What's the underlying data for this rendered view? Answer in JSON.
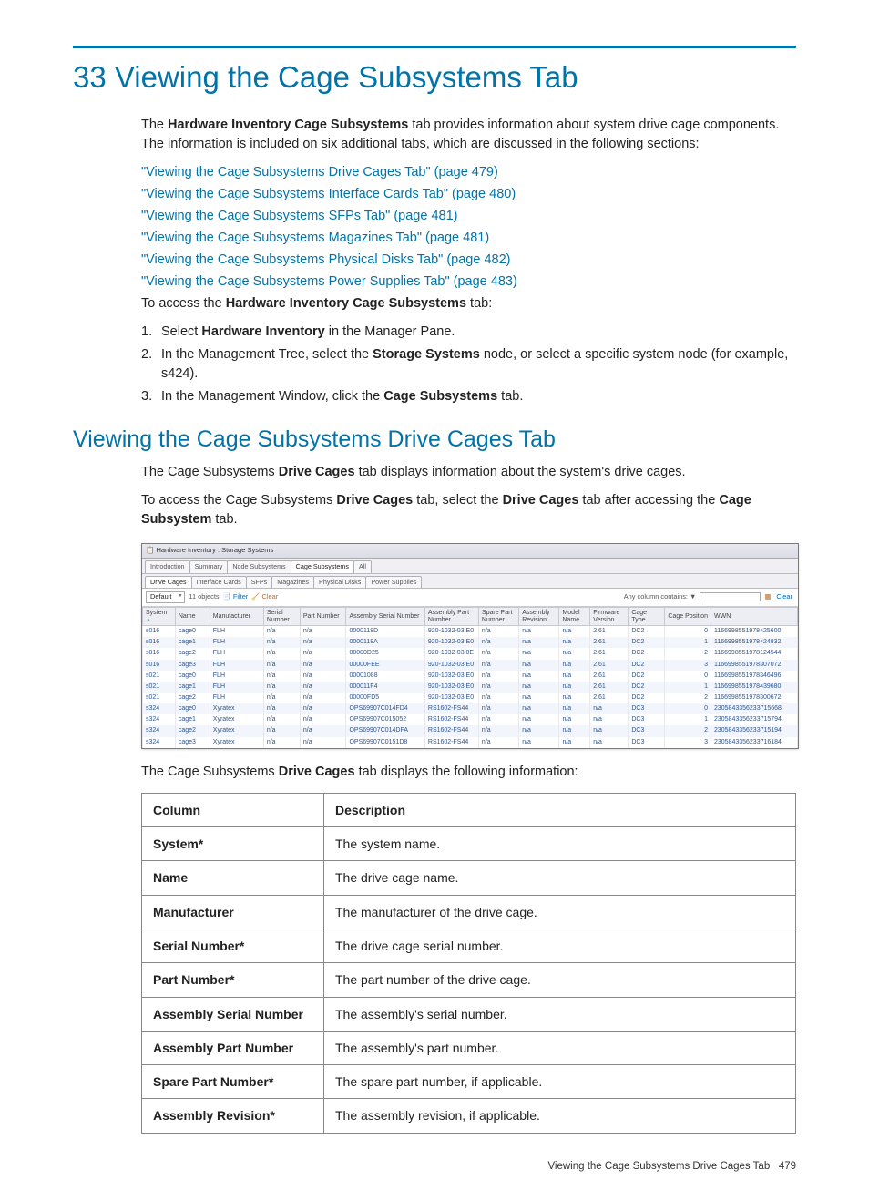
{
  "chapter": {
    "title": "33 Viewing the Cage Subsystems Tab",
    "intro_pre": "The ",
    "intro_bold": "Hardware Inventory Cage Subsystems",
    "intro_post": " tab provides information about system drive cage components. The information is included on six additional tabs, which are discussed in the following sections:",
    "links": [
      "\"Viewing the Cage Subsystems Drive Cages Tab\" (page 479)",
      "\"Viewing the Cage Subsystems Interface Cards Tab\" (page 480)",
      "\"Viewing the Cage Subsystems SFPs Tab\" (page 481)",
      "\"Viewing the Cage Subsystems Magazines Tab\" (page 481)",
      "\"Viewing the Cage Subsystems Physical Disks Tab\" (page 482)",
      "\"Viewing the Cage Subsystems Power Supplies Tab\" (page 483)"
    ],
    "access_pre": "To access the ",
    "access_bold": "Hardware Inventory Cage Subsystems",
    "access_post": " tab:",
    "steps": [
      {
        "n": "1.",
        "pre": "Select ",
        "b": "Hardware Inventory",
        "post": " in the Manager Pane."
      },
      {
        "n": "2.",
        "pre": "In the Management Tree, select the ",
        "b": "Storage Systems",
        "post": " node, or select a specific system node (for example, s424)."
      },
      {
        "n": "3.",
        "pre": "In the Management Window, click the ",
        "b": "Cage Subsystems",
        "post": " tab."
      }
    ]
  },
  "section2": {
    "title": "Viewing the Cage Subsystems Drive Cages Tab",
    "p1_pre": "The Cage Subsystems ",
    "p1_b": "Drive Cages",
    "p1_post": " tab displays information about the system's drive cages.",
    "p2_pre": "To access the Cage Subsystems ",
    "p2_b1": "Drive Cages",
    "p2_mid": " tab, select the ",
    "p2_b2": "Drive Cages",
    "p2_post": " tab after accessing the ",
    "p2_b3": "Cage Subsystem",
    "p2_end": " tab.",
    "p3_pre": "The Cage Subsystems ",
    "p3_b": "Drive Cages",
    "p3_post": " tab displays the following information:"
  },
  "screenshot": {
    "breadcrumb": "Hardware Inventory : Storage Systems",
    "tabs": [
      "Introduction",
      "Summary",
      "Node Subsystems",
      "Cage Subsystems",
      "All"
    ],
    "tabs_active": 3,
    "subtabs": [
      "Drive Cages",
      "Interface Cards",
      "SFPs",
      "Magazines",
      "Physical Disks",
      "Power Supplies"
    ],
    "subtabs_active": 0,
    "default_label": "Default",
    "objects": "11 objects",
    "filter": "Filter",
    "clear_small": "Clear",
    "anycol": "Any column contains:",
    "clear_btn": "Clear",
    "headers": [
      "System",
      "Name",
      "Manufacturer",
      "Serial Number",
      "Part Number",
      "Assembly Serial Number",
      "Assembly Part Number",
      "Spare Part Number",
      "Assembly Revision",
      "Model Name",
      "Firmware Version",
      "Cage Type",
      "Cage Position",
      "WWN"
    ],
    "col_widths": [
      "34",
      "36",
      "56",
      "38",
      "48",
      "82",
      "56",
      "42",
      "42",
      "32",
      "40",
      "38",
      "48",
      "90"
    ],
    "rows": [
      [
        "s016",
        "cage0",
        "FLH",
        "n/a",
        "n/a",
        "0000118D",
        "920-1032-03.E0",
        "n/a",
        "n/a",
        "n/a",
        "2.61",
        "DC2",
        "0",
        "1166998551978425600"
      ],
      [
        "s016",
        "cage1",
        "FLH",
        "n/a",
        "n/a",
        "0000118A",
        "920-1032-03.E0",
        "n/a",
        "n/a",
        "n/a",
        "2.61",
        "DC2",
        "1",
        "1166998551978424832"
      ],
      [
        "s016",
        "cage2",
        "FLH",
        "n/a",
        "n/a",
        "00000D25",
        "920-1032-03.0E",
        "n/a",
        "n/a",
        "n/a",
        "2.61",
        "DC2",
        "2",
        "1166998551978124544"
      ],
      [
        "s016",
        "cage3",
        "FLH",
        "n/a",
        "n/a",
        "00000FEE",
        "920-1032-03.E0",
        "n/a",
        "n/a",
        "n/a",
        "2.61",
        "DC2",
        "3",
        "1166998551978307072"
      ],
      [
        "s021",
        "cage0",
        "FLH",
        "n/a",
        "n/a",
        "00001088",
        "920-1032-03.E0",
        "n/a",
        "n/a",
        "n/a",
        "2.61",
        "DC2",
        "0",
        "1166998551978346496"
      ],
      [
        "s021",
        "cage1",
        "FLH",
        "n/a",
        "n/a",
        "000011F4",
        "920-1032-03.E0",
        "n/a",
        "n/a",
        "n/a",
        "2.61",
        "DC2",
        "1",
        "1166998551978439680"
      ],
      [
        "s021",
        "cage2",
        "FLH",
        "n/a",
        "n/a",
        "00000FD5",
        "920-1032-03.E0",
        "n/a",
        "n/a",
        "n/a",
        "2.61",
        "DC2",
        "2",
        "1166998551978300672"
      ],
      [
        "s324",
        "cage0",
        "Xyratex",
        "n/a",
        "n/a",
        "OPS69907C014FD4",
        "RS1602-FS44",
        "n/a",
        "n/a",
        "n/a",
        "n/a",
        "DC3",
        "0",
        "2305843356233715668"
      ],
      [
        "s324",
        "cage1",
        "Xyratex",
        "n/a",
        "n/a",
        "OPS69907C015052",
        "RS1602-FS44",
        "n/a",
        "n/a",
        "n/a",
        "n/a",
        "DC3",
        "1",
        "2305843356233715794"
      ],
      [
        "s324",
        "cage2",
        "Xyratex",
        "n/a",
        "n/a",
        "OPS69907C014DFA",
        "RS1602-FS44",
        "n/a",
        "n/a",
        "n/a",
        "n/a",
        "DC3",
        "2",
        "2305843356233715194"
      ],
      [
        "s324",
        "cage3",
        "Xyratex",
        "n/a",
        "n/a",
        "OPS69907C0151D8",
        "RS1602-FS44",
        "n/a",
        "n/a",
        "n/a",
        "n/a",
        "DC3",
        "3",
        "2305843356233716184"
      ]
    ]
  },
  "info_table": {
    "head_col": "Column",
    "head_desc": "Description",
    "rows": [
      [
        "System*",
        "The system name."
      ],
      [
        "Name",
        "The drive cage name."
      ],
      [
        "Manufacturer",
        "The manufacturer of the drive cage."
      ],
      [
        "Serial Number*",
        "The drive cage serial number."
      ],
      [
        "Part Number*",
        "The part number of the drive cage."
      ],
      [
        "Assembly Serial Number",
        "The assembly's serial number."
      ],
      [
        "Assembly Part Number",
        "The assembly's part number."
      ],
      [
        "Spare Part Number*",
        "The spare part number, if applicable."
      ],
      [
        "Assembly Revision*",
        "The assembly revision, if applicable."
      ]
    ]
  },
  "footer": {
    "text": "Viewing the Cage Subsystems Drive Cages Tab",
    "page": "479"
  }
}
